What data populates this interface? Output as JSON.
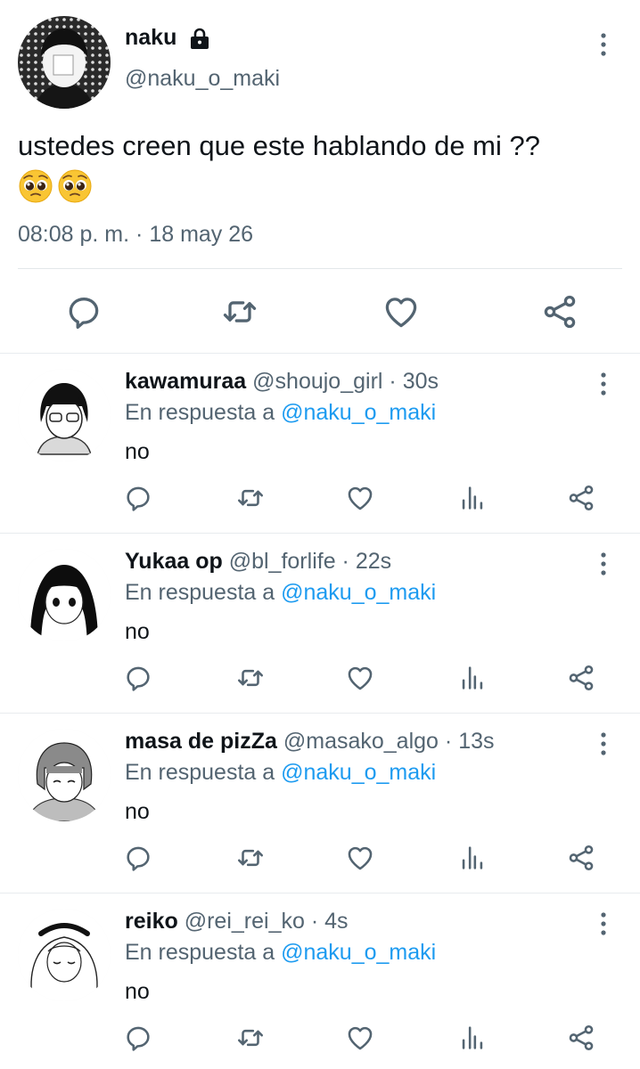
{
  "main_tweet": {
    "name": "naku",
    "handle": "@naku_o_maki",
    "text": "ustedes creen que este hablando de mi ??",
    "emoji_icons": [
      "pleading-face-icon",
      "pleading-face-icon"
    ],
    "time": "08:08 p. m.",
    "separator": "·",
    "date": "18 may 26",
    "icons": [
      "lock-icon",
      "more-icon",
      "reply-icon",
      "retweet-icon",
      "like-icon",
      "share-icon"
    ]
  },
  "replies": [
    {
      "name": "kawamuraa",
      "handle": "@shoujo_girl",
      "separator": "·",
      "time": "30s",
      "reply_prefix": "En respuesta a",
      "reply_to": "@naku_o_maki",
      "text": "no"
    },
    {
      "name": "Yukaa op",
      "handle": "@bl_forlife",
      "separator": "·",
      "time": "22s",
      "reply_prefix": "En respuesta a",
      "reply_to": "@naku_o_maki",
      "text": "no"
    },
    {
      "name": "masa de pizZa",
      "handle": "@masako_algo",
      "separator": "·",
      "time": "13s",
      "reply_prefix": "En respuesta a",
      "reply_to": "@naku_o_maki",
      "text": "no"
    },
    {
      "name": "reiko",
      "handle": "@rei_rei_ko",
      "separator": "·",
      "time": "4s",
      "reply_prefix": "En respuesta a",
      "reply_to": "@naku_o_maki",
      "text": "no"
    }
  ],
  "colors": {
    "text": "#0f1419",
    "secondary": "#536471",
    "link": "#1d9bf0",
    "divider": "#e8ecef"
  }
}
